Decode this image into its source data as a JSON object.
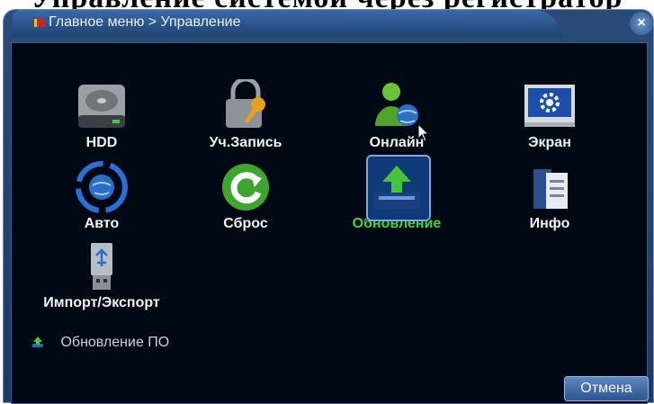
{
  "page_heading": "Управление системой через регистратор",
  "window": {
    "title": "Главное меню > Управление",
    "close_glyph": "×"
  },
  "menu": {
    "items": [
      {
        "label": "HDD",
        "icon": "hdd-icon"
      },
      {
        "label": "Уч.Запись",
        "icon": "lock-key-icon"
      },
      {
        "label": "Онлайн",
        "icon": "online-user-icon"
      },
      {
        "label": "Экран",
        "icon": "screen-gear-icon"
      },
      {
        "label": "Авто",
        "icon": "auto-globe-icon"
      },
      {
        "label": "Сброс",
        "icon": "reset-icon"
      },
      {
        "label": "Обновление",
        "icon": "update-icon",
        "selected": true
      },
      {
        "label": "Инфо",
        "icon": "info-icon"
      },
      {
        "label": "Импорт/Экспорт",
        "icon": "usb-icon"
      }
    ]
  },
  "footer": {
    "hint": "Обновление ПО",
    "hint_icon": "update-small-icon",
    "cancel_label": "Отмена"
  },
  "colors": {
    "selected_label": "#3ed23e",
    "panel_bg": "#000814",
    "window_frame": "#2a4a78"
  }
}
